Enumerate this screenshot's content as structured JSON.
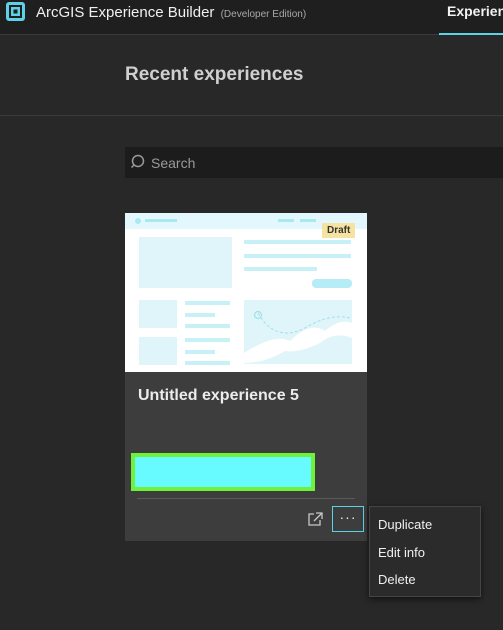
{
  "app": {
    "title": "ArcGIS Experience Builder",
    "edition": "(Developer Edition)"
  },
  "nav": {
    "active_tab": "Experiences"
  },
  "page": {
    "title": "Recent experiences"
  },
  "search": {
    "placeholder": "Search",
    "value": ""
  },
  "card": {
    "title": "Untitled experience 5",
    "badge": "Draft"
  },
  "context_menu": {
    "items": [
      "Duplicate",
      "Edit info",
      "Delete"
    ]
  },
  "colors": {
    "accent": "#5dd1e6",
    "badge_bg": "#f7e3a1",
    "redaction_fill": "#67fbff",
    "redaction_border": "#6ef23a"
  }
}
